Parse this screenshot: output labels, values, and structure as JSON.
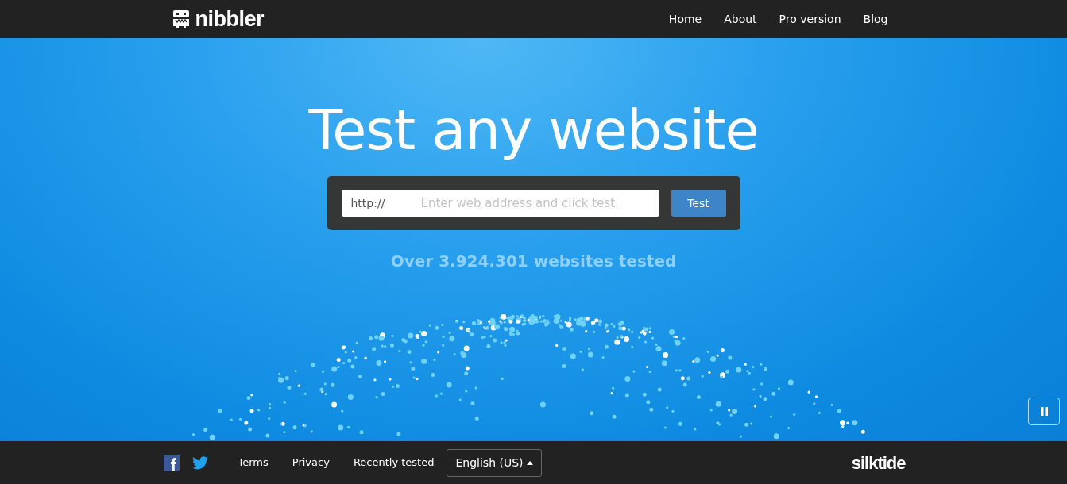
{
  "navbar": {
    "brand": "nibbler",
    "links": [
      {
        "label": "Home"
      },
      {
        "label": "About"
      },
      {
        "label": "Pro version"
      },
      {
        "label": "Blog"
      }
    ]
  },
  "hero": {
    "title": "Test any website",
    "form": {
      "prefix": "http://",
      "placeholder": "Enter web address and click test.",
      "button": "Test"
    },
    "counter": "Over 3.924.301 websites tested"
  },
  "footer": {
    "links": [
      {
        "label": "Terms"
      },
      {
        "label": "Privacy"
      },
      {
        "label": "Recently tested"
      }
    ],
    "language": "English (US)",
    "logo": "silktide"
  }
}
